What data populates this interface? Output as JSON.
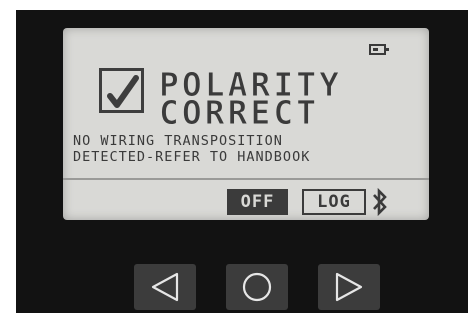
{
  "screen": {
    "title_line1": "POLARITY",
    "title_line2": "CORRECT",
    "message_line1": "NO WIRING TRANSPOSITION",
    "message_line2": "DETECTED-REFER TO HANDBOOK",
    "off_label": "OFF",
    "log_label": "LOG",
    "icons": [
      "battery-icon",
      "checkmark-icon",
      "bluetooth-icon"
    ]
  },
  "nav": {
    "icons": [
      "left-arrow-icon",
      "circle-icon",
      "right-arrow-icon"
    ]
  },
  "colors": {
    "lcd_background": "#d9d9d6",
    "lcd_ink": "#3b3b3b",
    "device_body": "#121212",
    "button_face": "#3c3c3c"
  }
}
